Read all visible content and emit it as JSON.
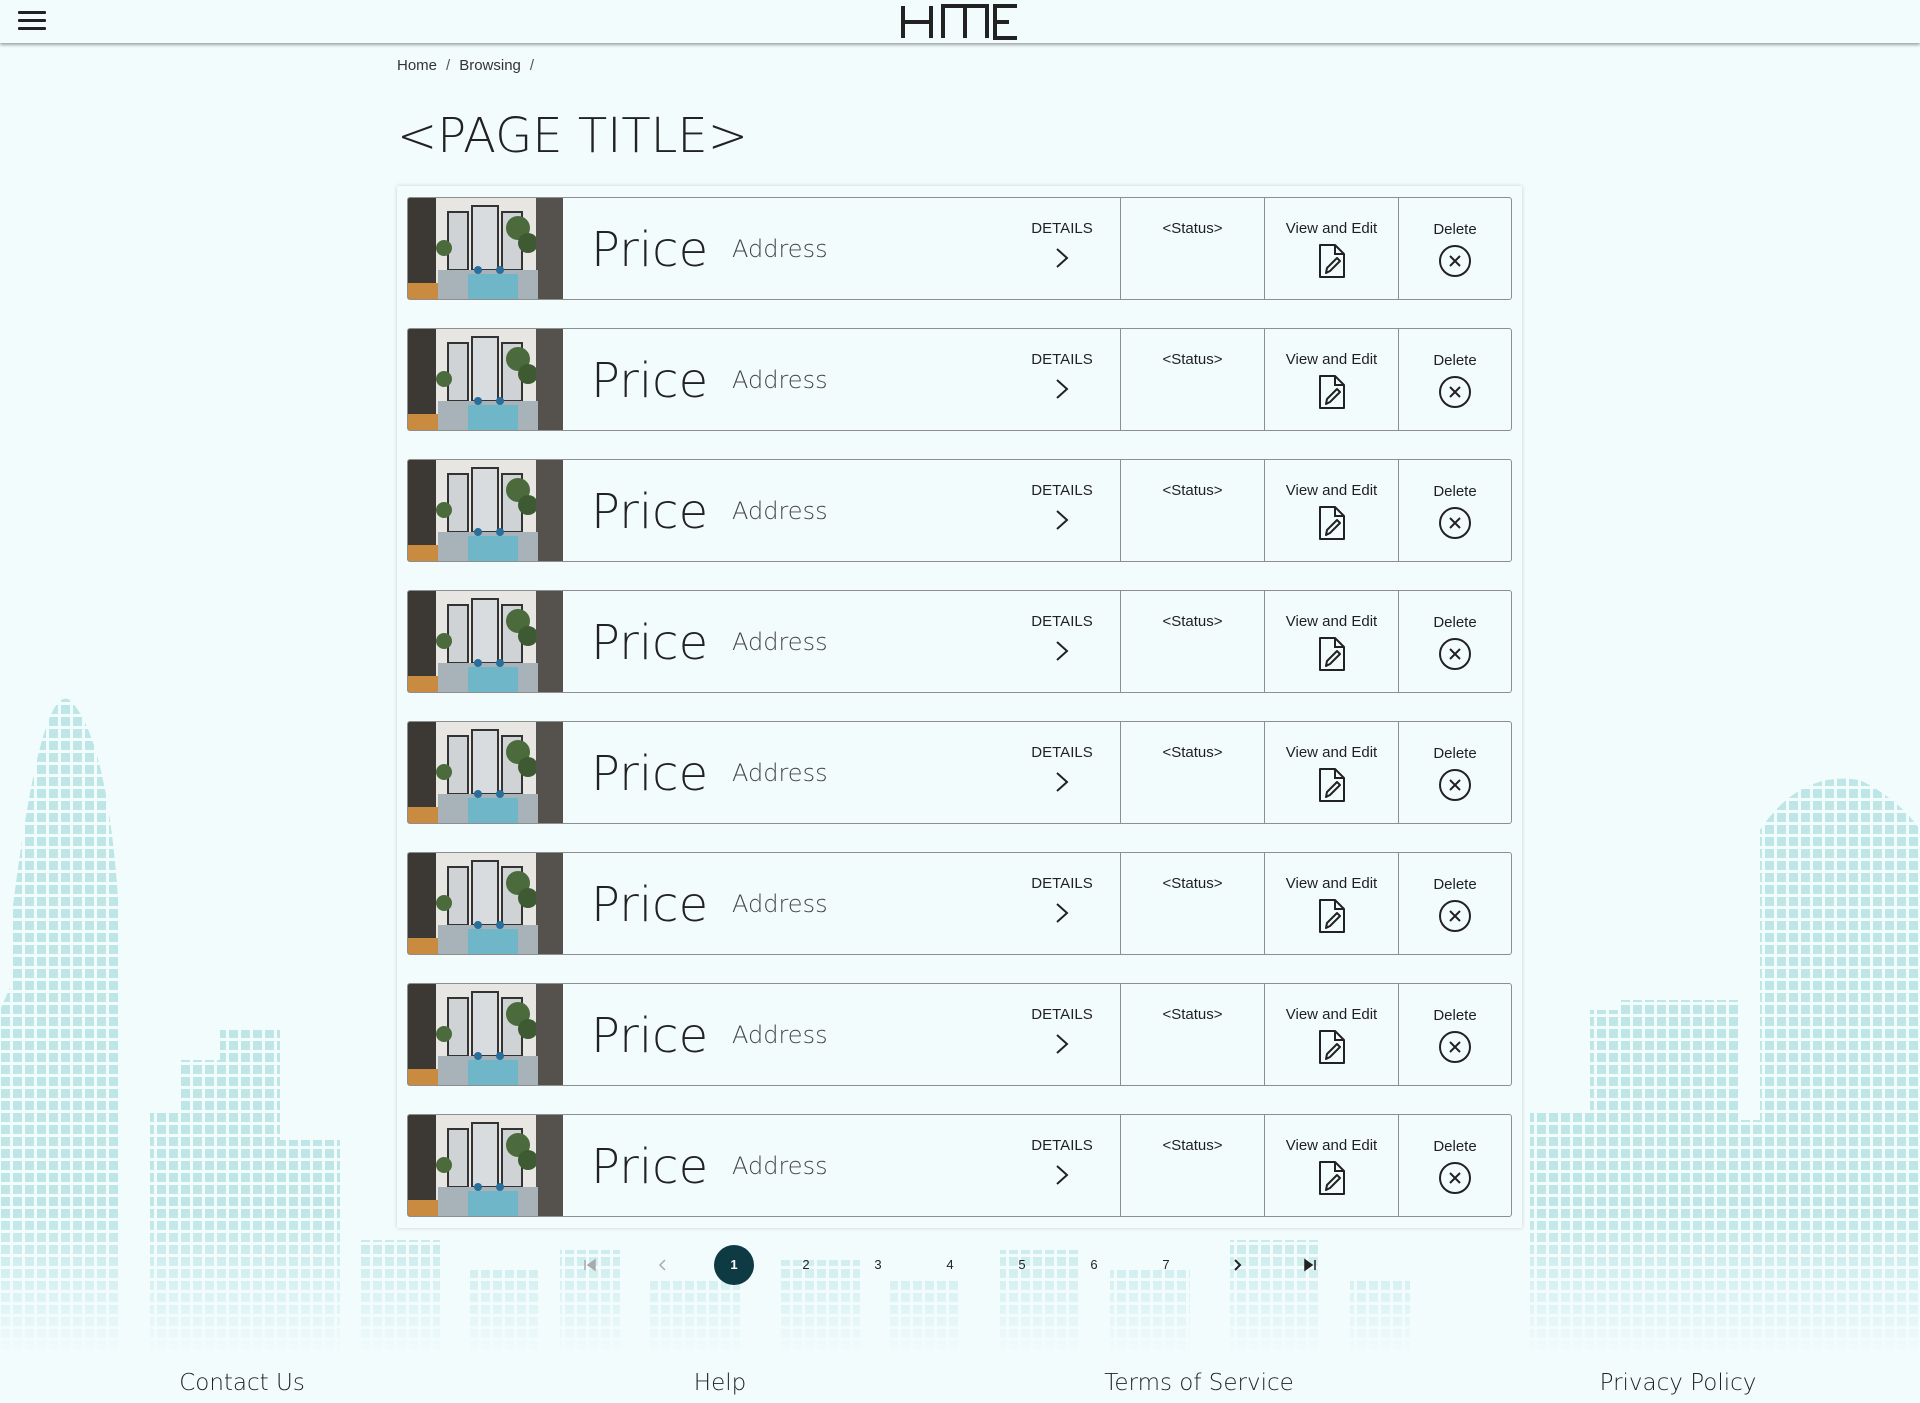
{
  "header": {
    "logo_text": "HME",
    "menu_icon": "hamburger-menu-icon"
  },
  "breadcrumb": {
    "items": [
      "Home",
      "Browsing"
    ],
    "separator": "/"
  },
  "page_title": "<PAGE TITLE>",
  "listings": [
    {
      "price": "Price",
      "address": "Address",
      "details_label": "DETAILS",
      "status": "<Status>",
      "edit_label": "View and Edit",
      "delete_label": "Delete"
    },
    {
      "price": "Price",
      "address": "Address",
      "details_label": "DETAILS",
      "status": "<Status>",
      "edit_label": "View and Edit",
      "delete_label": "Delete"
    },
    {
      "price": "Price",
      "address": "Address",
      "details_label": "DETAILS",
      "status": "<Status>",
      "edit_label": "View and Edit",
      "delete_label": "Delete"
    },
    {
      "price": "Price",
      "address": "Address",
      "details_label": "DETAILS",
      "status": "<Status>",
      "edit_label": "View and Edit",
      "delete_label": "Delete"
    },
    {
      "price": "Price",
      "address": "Address",
      "details_label": "DETAILS",
      "status": "<Status>",
      "edit_label": "View and Edit",
      "delete_label": "Delete"
    },
    {
      "price": "Price",
      "address": "Address",
      "details_label": "DETAILS",
      "status": "<Status>",
      "edit_label": "View and Edit",
      "delete_label": "Delete"
    },
    {
      "price": "Price",
      "address": "Address",
      "details_label": "DETAILS",
      "status": "<Status>",
      "edit_label": "View and Edit",
      "delete_label": "Delete"
    },
    {
      "price": "Price",
      "address": "Address",
      "details_label": "DETAILS",
      "status": "<Status>",
      "edit_label": "View and Edit",
      "delete_label": "Delete"
    }
  ],
  "pagination": {
    "pages": [
      "1",
      "2",
      "3",
      "4",
      "5",
      "6",
      "7"
    ],
    "current_page": "1"
  },
  "footer": {
    "links": [
      "Contact Us",
      "Help",
      "Terms of Service",
      "Privacy Policy"
    ]
  },
  "colors": {
    "background": "#f3fcfd",
    "active_page": "#0e3a44",
    "city_tint": "#c6e9ea"
  }
}
